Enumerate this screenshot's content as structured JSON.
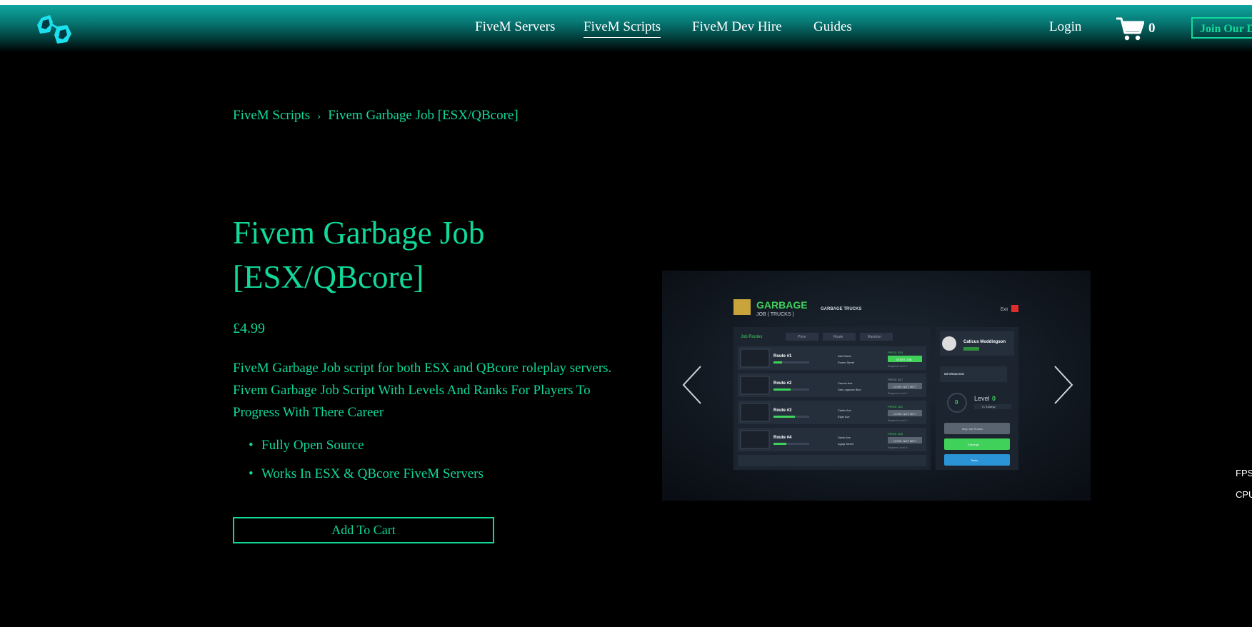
{
  "nav": {
    "links": [
      "FiveM Servers",
      "FiveM Scripts",
      "FiveM Dev Hire",
      "Guides"
    ],
    "login": "Login",
    "cart_count": "0",
    "discord_button": "Join Our Di"
  },
  "breadcrumb": {
    "parent": "FiveM Scripts",
    "separator": "›",
    "current": "Fivem Garbage Job [ESX/QBcore]"
  },
  "product": {
    "title": "Fivem Garbage Job [ESX/QBcore]",
    "price": "£4.99",
    "description": "FiveM Garbage Job script for both ESX and QBcore roleplay servers. Fivem Garbage Job Script With Levels And Ranks For Players To Progress With There Career",
    "features": [
      "Fully Open Source",
      "Works In ESX & QBcore FiveM Servers"
    ],
    "add_to_cart": "Add To Cart"
  },
  "screenshot": {
    "logo_title": "GARBAGE",
    "logo_sub": "JOB ( TRUCKS )",
    "section": "GARBAGE TRUCKS",
    "exit": "Exit",
    "tabs": [
      "Job Routes",
      "Price",
      "Route",
      "Random"
    ],
    "routes": [
      {
        "name": "Route #1",
        "streets": [
          "Alta Street",
          "Power Street"
        ],
        "price": "PRICE: $15",
        "action": "START JOB",
        "req": "Required Level: 0"
      },
      {
        "name": "Route #2",
        "streets": [
          "Carson Ave",
          "San Lagonas Blvd"
        ],
        "price": "PRICE: $17",
        "action": "LEVEL NOT MET",
        "req": "Required Level: 1"
      },
      {
        "name": "Route #3",
        "streets": [
          "Calais Ave",
          "Elgin Ave"
        ],
        "price": "PRICE: $22",
        "action": "LEVEL NOT MET",
        "req": "Required Level: 3"
      },
      {
        "name": "Route #4",
        "streets": [
          "Davis Ave",
          "Aguja Street"
        ],
        "price": "PRICE: $25",
        "action": "LEVEL NOT MET",
        "req": "Required Level: 5"
      }
    ],
    "player_name": "Caticus Moddingson",
    "info_label": "INFORMATION",
    "level_label": "Level",
    "level_value": "0",
    "xp": "0 / 100exp",
    "buttons": [
      "Map Job Routes",
      "Earnings",
      "Tasks"
    ]
  },
  "overlay": {
    "fps": "FPS",
    "cpu": "CPU"
  }
}
